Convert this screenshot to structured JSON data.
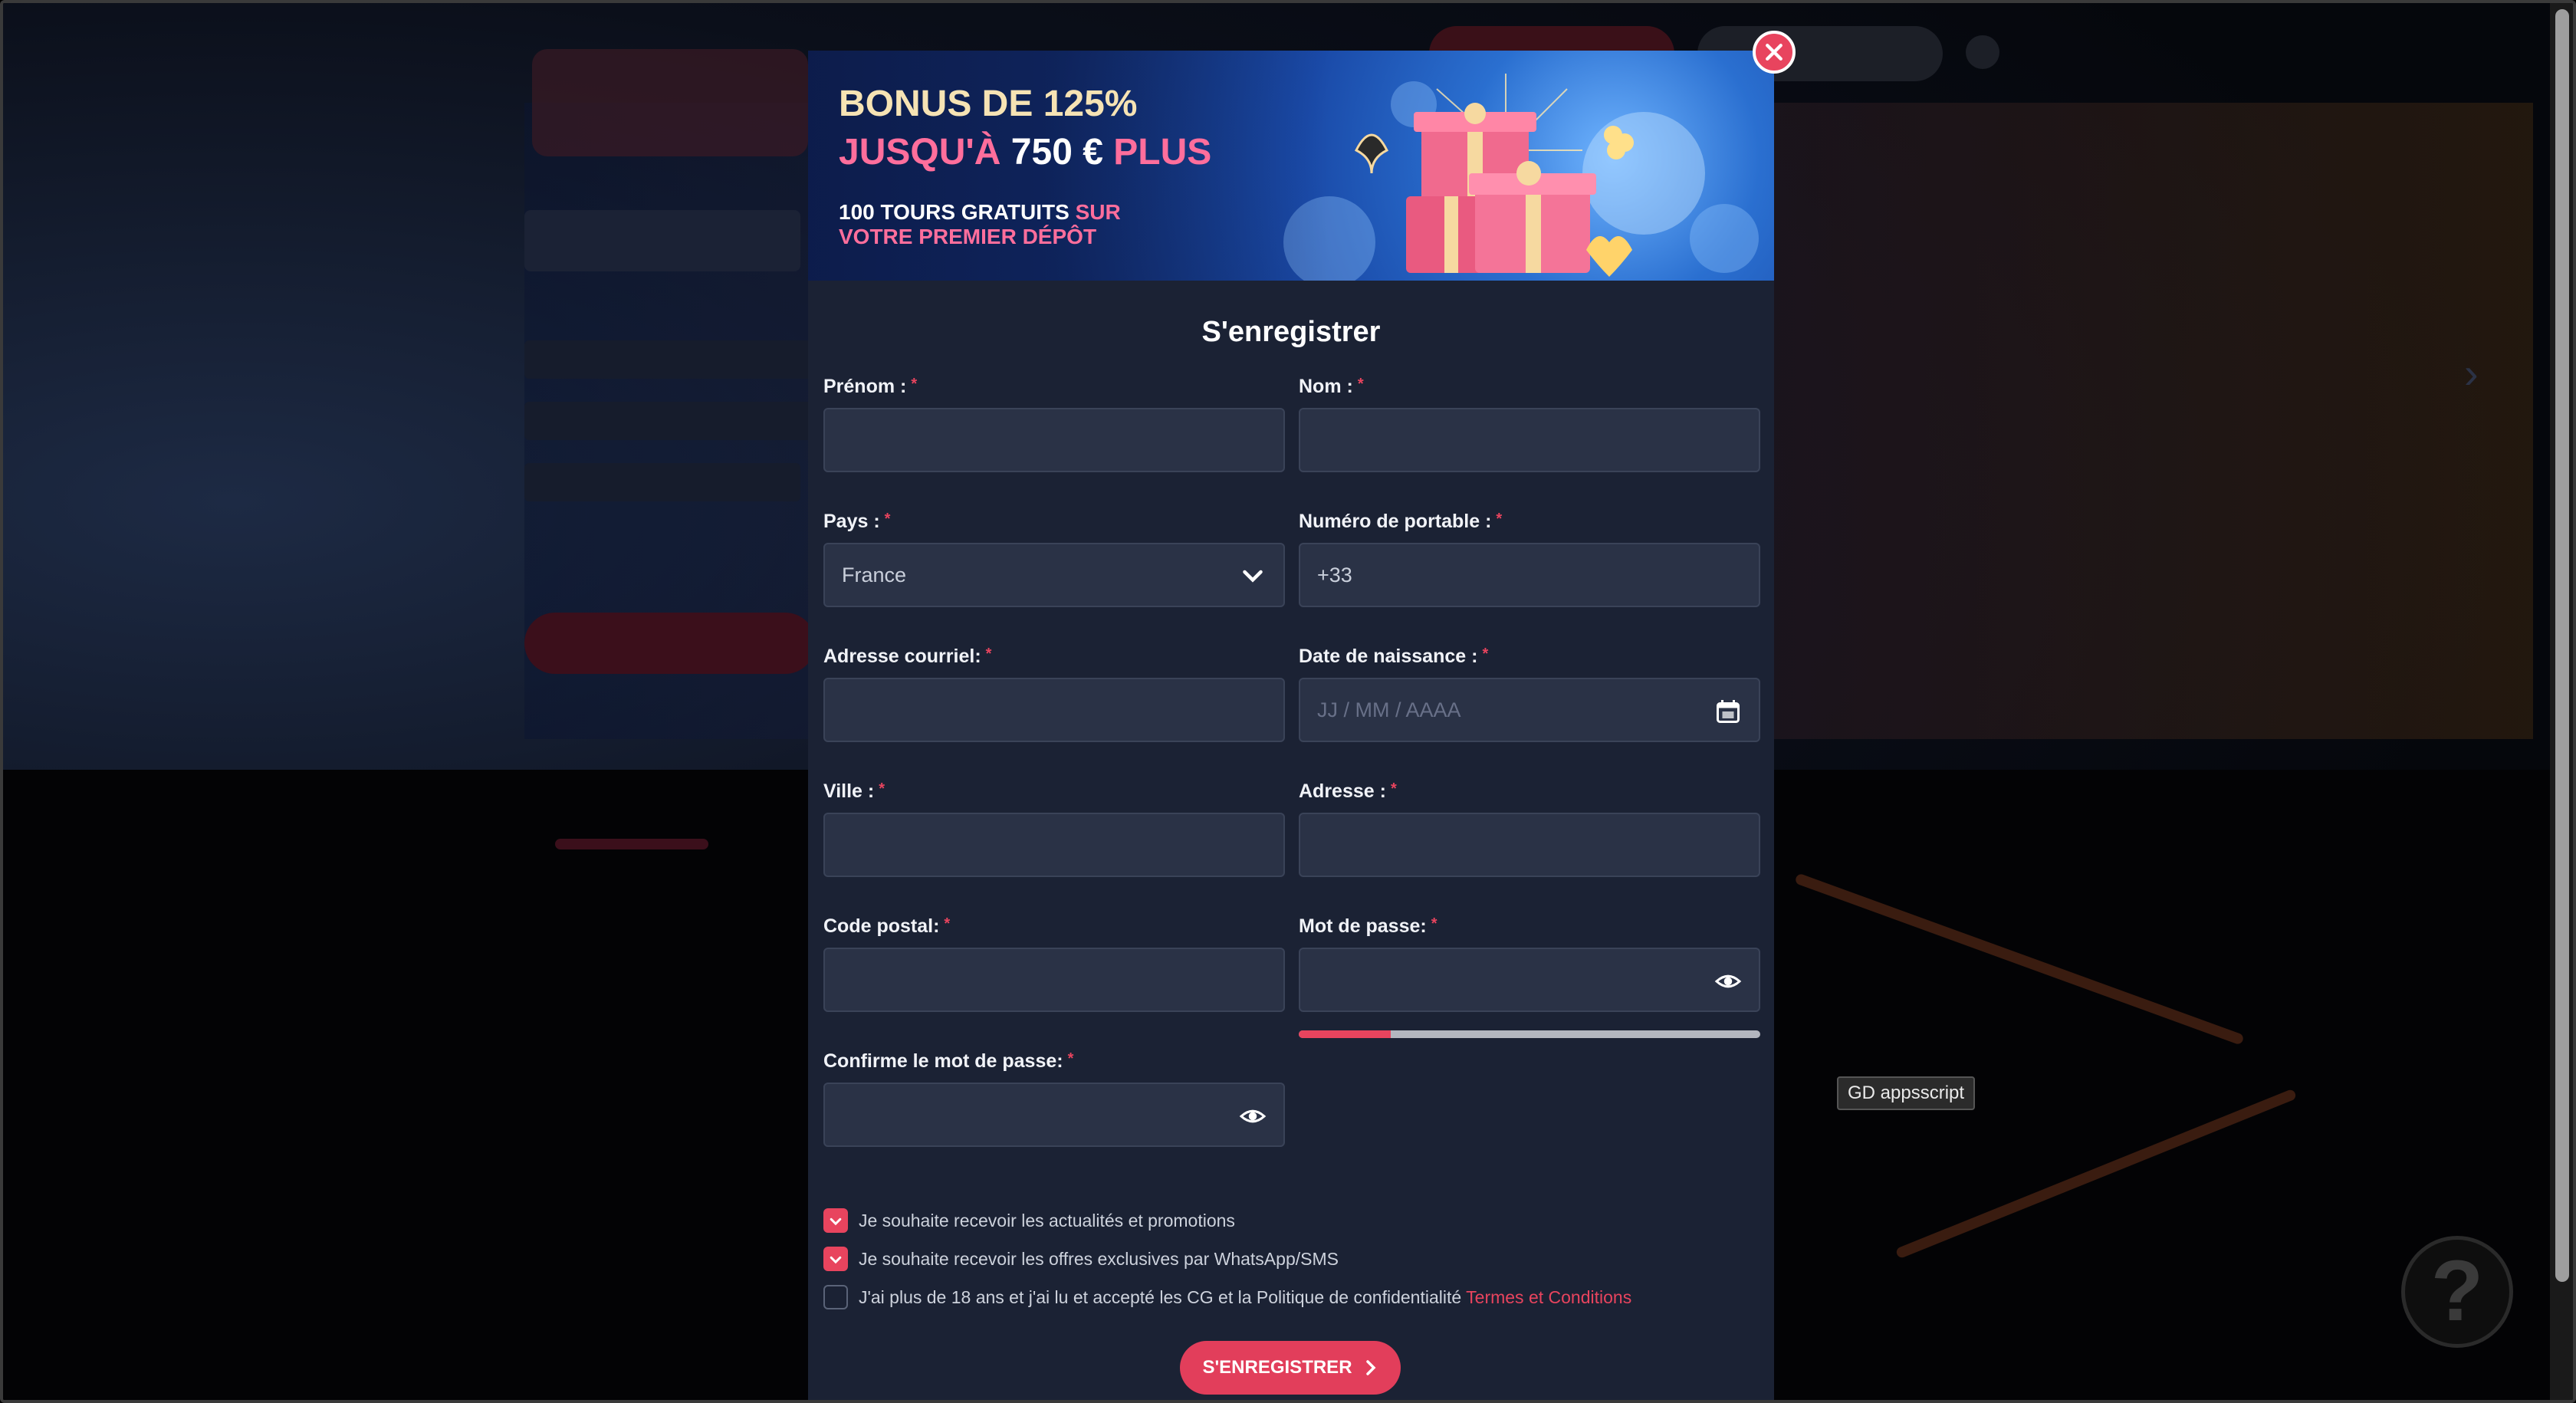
{
  "background": {
    "help_label": "?"
  },
  "tooltip": {
    "text": "GD appsscript"
  },
  "banner": {
    "line1": "BONUS DE 125%",
    "line2_prefix": "JUSQU'À",
    "line2_amount": "750 €",
    "line2_suffix": "PLUS",
    "line3_a": "100 TOURS GRATUITS",
    "line3_b": "SUR",
    "line3_c": "VOTRE PREMIER DÉPÔT"
  },
  "modal": {
    "title": "S'enregistrer",
    "required_mark": "*"
  },
  "fields": {
    "prenom": {
      "label": "Prénom :",
      "value": ""
    },
    "nom": {
      "label": "Nom :",
      "value": ""
    },
    "pays": {
      "label": "Pays :",
      "value": "France"
    },
    "portable": {
      "label": "Numéro de portable :",
      "value": "+33"
    },
    "email": {
      "label": "Adresse courriel:",
      "value": ""
    },
    "naissance": {
      "label": "Date de naissance :",
      "placeholder": "JJ / MM / AAAA"
    },
    "ville": {
      "label": "Ville :",
      "value": ""
    },
    "adresse": {
      "label": "Adresse :",
      "value": ""
    },
    "code_postal": {
      "label": "Code postal:",
      "value": ""
    },
    "mot_de_passe": {
      "label": "Mot de passe:",
      "value": "",
      "strength": 0.2
    },
    "confirme": {
      "label": "Confirme le mot de passe:",
      "value": ""
    }
  },
  "checkboxes": [
    {
      "text": "Je souhaite recevoir les actualités et promotions",
      "checked": true
    },
    {
      "text": "Je souhaite recevoir les offres exclusives par WhatsApp/SMS",
      "checked": true
    },
    {
      "text": "J'ai plus de 18 ans et j'ai lu et accepté les CG et la Politique de confidentialité",
      "link": "Termes et Conditions",
      "checked": false
    }
  ],
  "submit": {
    "label": "S'ENREGISTRER"
  },
  "colors": {
    "accent": "#e8445e",
    "modal_bg": "#1b2234",
    "input_bg": "#2a3246"
  }
}
